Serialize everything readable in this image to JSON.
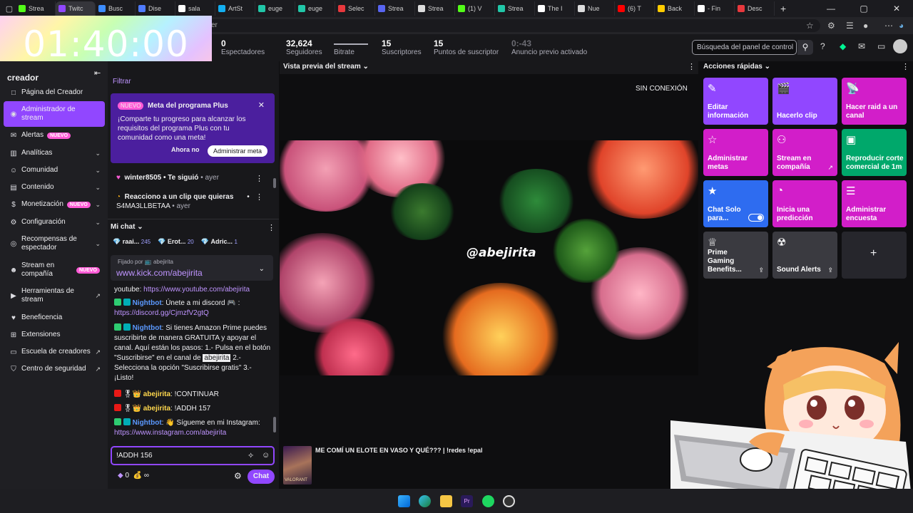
{
  "browser": {
    "tabs": [
      {
        "label": "Strea",
        "color": "#53fc18"
      },
      {
        "label": "Twitc",
        "color": "#9147ff",
        "active": true
      },
      {
        "label": "Busc",
        "color": "#3c8cff"
      },
      {
        "label": "Dise",
        "color": "#4f7bff"
      },
      {
        "label": "sala",
        "color": "#ffffff"
      },
      {
        "label": "ArtSt",
        "color": "#13aff0"
      },
      {
        "label": "euge",
        "color": "#21c7a8"
      },
      {
        "label": "euge",
        "color": "#21c7a8"
      },
      {
        "label": "Selec",
        "color": "#e8383d"
      },
      {
        "label": "Strea",
        "color": "#5865f2"
      },
      {
        "label": "Strea",
        "color": "#dddddd"
      },
      {
        "label": "(1) V",
        "color": "#53fc18"
      },
      {
        "label": "Strea",
        "color": "#21c7a8"
      },
      {
        "label": "The I",
        "color": "#ffffff"
      },
      {
        "label": "Nue",
        "color": "#dddddd"
      },
      {
        "label": "(6) T",
        "color": "#ff0000"
      },
      {
        "label": "Back",
        "color": "#ffcc00"
      },
      {
        "label": "- Fin",
        "color": "#ffffff"
      },
      {
        "label": "Desc",
        "color": "#e8383d"
      }
    ],
    "new_tab": "+",
    "url_fragment": "er"
  },
  "timer": "01:40:00",
  "stats": [
    {
      "value": "0",
      "label": "Espectadores"
    },
    {
      "value": "32,624",
      "label": "Seguidores"
    },
    {
      "value": "",
      "label": "Bitrate"
    },
    {
      "value": "15",
      "label": "Suscriptores"
    },
    {
      "value": "15",
      "label": "Puntos de suscriptor"
    },
    {
      "value": "0:-43",
      "label": "Anuncio previo activado"
    }
  ],
  "search_placeholder": "Búsqueda del panel de control",
  "sidebar": {
    "title": "creador",
    "items": [
      {
        "label": "Página del Creador",
        "icon": "□"
      },
      {
        "label": "Administrador de stream",
        "icon": "◉",
        "selected": true
      },
      {
        "label": "Alertas",
        "icon": "✉",
        "badge": "NUEVO"
      },
      {
        "label": "Analíticas",
        "icon": "▥",
        "chevron": true
      },
      {
        "label": "Comunidad",
        "icon": "☺",
        "chevron": true
      },
      {
        "label": "Contenido",
        "icon": "▤",
        "chevron": true
      },
      {
        "label": "Monetización",
        "icon": "$",
        "badge": "NUEVO",
        "chevron": true
      },
      {
        "label": "Configuración",
        "icon": "⚙",
        "chevron": true
      },
      {
        "label": "Recompensas de espectador",
        "icon": "◎",
        "chevron": true
      },
      {
        "label": "Stream en compañía",
        "icon": "☻",
        "badge": "NUEVO"
      },
      {
        "label": "Herramientas de stream",
        "icon": "▶",
        "external": true
      },
      {
        "label": "Beneficencia",
        "icon": "♥"
      },
      {
        "label": "Extensiones",
        "icon": "⊞"
      },
      {
        "label": "Escuela de creadores",
        "icon": "▭",
        "external": true
      },
      {
        "label": "Centro de seguridad",
        "icon": "⛉",
        "external": true
      }
    ]
  },
  "activity": {
    "filter": "Filtrar",
    "plus_card": {
      "badge": "NUEVO",
      "title": "Meta del programa Plus",
      "desc": "¡Comparte tu progreso para alcanzar los requisitos del programa Plus con tu comunidad como una meta!",
      "btn_later": "Ahora no",
      "btn_admin": "Administrar meta"
    },
    "events": [
      {
        "user": "winter8505",
        "text": " • Te siguió",
        "time": " • ayer"
      },
      {
        "user": "Reacciono a un clip que quieras",
        "text": " • S4MA3LLBETAA",
        "time": " • ayer"
      }
    ]
  },
  "chat": {
    "title": "Mi chat",
    "top_chatters": [
      {
        "name": "raai...",
        "count": "245"
      },
      {
        "name": "Erot...",
        "count": "20"
      },
      {
        "name": "Adric...",
        "count": "1"
      }
    ],
    "pinned_by": "Fijado por 📺 abejirita",
    "pinned_link": "www.kick.com/abejirita",
    "msg_youtube_label": "youtube: ",
    "msg_youtube_link": "https://www.youtube.com/abejirita",
    "msg1_user": "Nightbot",
    "msg1_text": ": Únete a mi discord 🎮 :",
    "msg1_link": "https://discord.gg/CjmzfV2gtQ",
    "msg2_user": "Nightbot",
    "msg2_text": ": Si tienes Amazon Prime puedes suscribirte de manera GRATUITA y apoyar el canal. Aquí están los pasos: 1.- Pulsa en el botón \"Suscribirse\" en el canal de ",
    "msg2_hl": "abejirita",
    "msg2_end": " 2.- Selecciona la opción \"Suscribirse gratis\" 3.- ¡Listo!",
    "msg3_user": "abejirita",
    "msg3_text": ": !CONTINUAR",
    "msg4_user": "abejirita",
    "msg4_text": ": !ADDH 157",
    "msg5_user": "Nightbot",
    "msg5_text": ": 👋 Sígueme en mi Instagram:",
    "msg5_link": "https://www.instagram.com/abejirita",
    "input_value": "!ADDH 156",
    "points": "0",
    "infinity": "∞",
    "chat_button": "Chat"
  },
  "preview": {
    "title": "Vista previa del stream",
    "status": "SIN CONEXIÓN",
    "handle": "@abejirita",
    "game_title": "ME COMÍ UN ELOTE EN VASO Y QUÉ??? | !redes !epal",
    "game_name": "VALORANT"
  },
  "quick_actions": {
    "title": "Acciones rápidas",
    "items": [
      {
        "label": "Editar información",
        "icon": "✎",
        "color": "#9147ff"
      },
      {
        "label": "Hacerlo clip",
        "icon": "🎬",
        "color": "#9147ff"
      },
      {
        "label": "Hacer raid a un canal",
        "icon": "📡",
        "color": "#d21ec9"
      },
      {
        "label": "Administrar metas",
        "icon": "☆",
        "color": "#d21ec9"
      },
      {
        "label": "Stream en compañía",
        "icon": "⚇",
        "color": "#d21ec9",
        "external": true
      },
      {
        "label": "Reproducir corte comercial de 1m",
        "icon": "▣",
        "color": "#00a86b"
      },
      {
        "label": "Chat Solo para...",
        "icon": "★",
        "color": "#2e6cf0",
        "toggle": true
      },
      {
        "label": "Inicia una predicción",
        "icon": "◔",
        "color": "#d21ec9"
      },
      {
        "label": "Administrar encuesta",
        "icon": "☰",
        "color": "#d21ec9"
      },
      {
        "label": "Prime Gaming Benefits...",
        "icon": "♕",
        "color": "#3a3a40",
        "pin": true
      },
      {
        "label": "Sound Alerts",
        "icon": "☢",
        "color": "#3a3a40",
        "pin": true
      },
      {
        "label": "",
        "icon": "+",
        "color": "#26262c"
      }
    ]
  }
}
